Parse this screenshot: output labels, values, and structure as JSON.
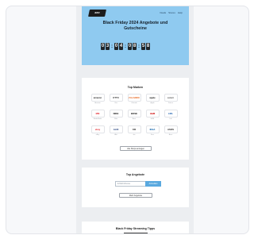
{
  "hero": {
    "logo_text": "BFD",
    "links": [
      "Deals",
      "Stores",
      "Help"
    ],
    "title": "Black Friday 2024 Angebote und Gutscheine",
    "countdown": [
      "03",
      "04",
      "08",
      "58"
    ]
  },
  "stores": {
    "title": "Top Marken",
    "items": [
      {
        "label": "amazon",
        "caption": "Amazon",
        "color": "#222222"
      },
      {
        "label": "OTTO",
        "caption": "Otto",
        "color": "#333333"
      },
      {
        "label": "ZALANDO",
        "caption": "Zalando",
        "color": "#e8641b"
      },
      {
        "label": "apple",
        "caption": "Apple",
        "color": "#111111"
      },
      {
        "label": "saturn",
        "caption": "Saturn",
        "color": "#555555"
      },
      {
        "label": "MM",
        "caption": "MediaMarkt",
        "color": "#e3262f"
      },
      {
        "label": "NIKE",
        "caption": "Nike",
        "color": "#111111"
      },
      {
        "label": "BOSE",
        "caption": "Bose",
        "color": "#111111"
      },
      {
        "label": "H&M",
        "caption": "H&M",
        "color": "#cc0000"
      },
      {
        "label": "LIDL",
        "caption": "Lidl",
        "color": "#1b5fad"
      },
      {
        "label": "ebay",
        "caption": "eBay",
        "color": "#e53238"
      },
      {
        "label": "ALDI",
        "caption": "Aldi",
        "color": "#1e3c7a"
      },
      {
        "label": "DM",
        "caption": "dm",
        "color": "#444444"
      },
      {
        "label": "IKEA",
        "caption": "Ikea",
        "color": "#0058a3"
      },
      {
        "label": "ASOS",
        "caption": "Asos",
        "color": "#222222"
      }
    ],
    "all_button": "Alle Shops anzeigen"
  },
  "newsletter": {
    "title": "Top Angebote",
    "placeholder": "E-Mail Adresse",
    "submit": "Anmelden",
    "more_button": "Mehr Angebote"
  },
  "stream": {
    "title": "Black Friday Streaming Tipps"
  }
}
